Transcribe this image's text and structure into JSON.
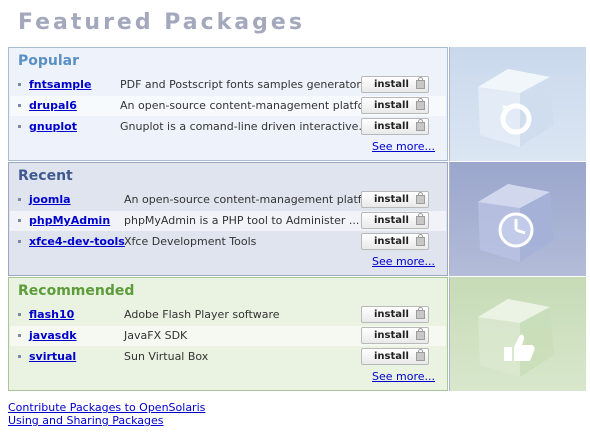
{
  "page": {
    "title": "Featured Packages"
  },
  "sections": [
    {
      "title": "Popular",
      "packages": [
        {
          "name": "fntsample",
          "description": "PDF and Postscript fonts samples generator",
          "button": "install"
        },
        {
          "name": "drupal6",
          "description": "An open-source content-management platform",
          "button": "install"
        },
        {
          "name": "gnuplot",
          "description": "Gnuplot is a comand-line driven interactive...",
          "button": "install"
        }
      ],
      "see_more": "See more...",
      "icon": "refresh-arrow-icon"
    },
    {
      "title": "Recent",
      "packages": [
        {
          "name": "joomla",
          "description": "An open-source content-management platform",
          "button": "install"
        },
        {
          "name": "phpMyAdmin",
          "description": "phpMyAdmin is a PHP tool to Administer ...",
          "button": "install"
        },
        {
          "name": "xfce4-dev-tools",
          "description": "Xfce Development Tools",
          "button": "install"
        }
      ],
      "see_more": "See more...",
      "icon": "clock-icon"
    },
    {
      "title": "Recommended",
      "packages": [
        {
          "name": "flash10",
          "description": "Adobe Flash Player software",
          "button": "install"
        },
        {
          "name": "javasdk",
          "description": "JavaFX SDK",
          "button": "install"
        },
        {
          "name": "svirtual",
          "description": "Sun Virtual Box",
          "button": "install"
        }
      ],
      "see_more": "See more...",
      "icon": "thumbs-up-icon"
    }
  ],
  "footer": {
    "links": [
      "Contribute Packages to OpenSolaris",
      "Using and Sharing Packages"
    ]
  },
  "colors": {
    "title": "#a3a8bd",
    "popular": "#5a8fc4",
    "recent": "#3f5a8e",
    "recommended": "#5c9c3a",
    "link": "#0000cc"
  }
}
